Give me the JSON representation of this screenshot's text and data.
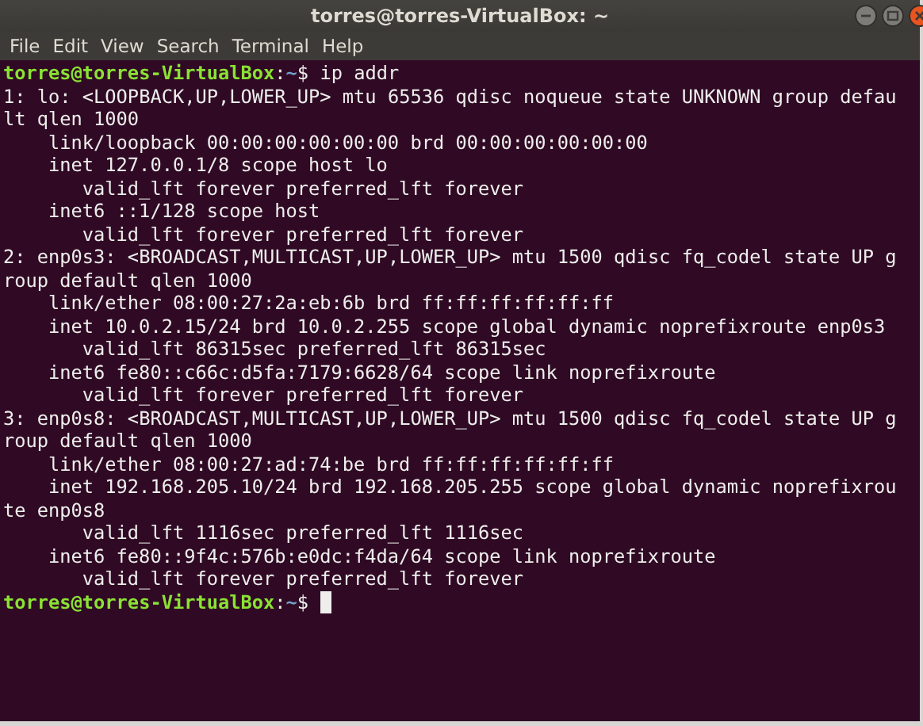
{
  "window": {
    "title": "torres@torres-VirtualBox: ~"
  },
  "menu": [
    "File",
    "Edit",
    "View",
    "Search",
    "Terminal",
    "Help"
  ],
  "terminal": {
    "lines": [
      {
        "kind": "prompt",
        "user_host": "torres@torres-VirtualBox",
        "separator": ":",
        "path": "~",
        "symbol": "$",
        "command": "ip addr",
        "cursor": false
      },
      {
        "kind": "line",
        "text": "1: lo: <LOOPBACK,UP,LOWER_UP> mtu 65536 qdisc noqueue state UNKNOWN group defau"
      },
      {
        "kind": "line",
        "text": "lt qlen 1000"
      },
      {
        "kind": "indented",
        "text": "link/loopback 00:00:00:00:00:00 brd 00:00:00:00:00:00"
      },
      {
        "kind": "indented",
        "text": "inet 127.0.0.1/8 scope host lo"
      },
      {
        "kind": "subindented",
        "text": "valid_lft forever preferred_lft forever"
      },
      {
        "kind": "indented",
        "text": "inet6 ::1/128 scope host"
      },
      {
        "kind": "subindented",
        "text": "valid_lft forever preferred_lft forever"
      },
      {
        "kind": "line",
        "text": "2: enp0s3: <BROADCAST,MULTICAST,UP,LOWER_UP> mtu 1500 qdisc fq_codel state UP g"
      },
      {
        "kind": "line",
        "text": "roup default qlen 1000"
      },
      {
        "kind": "indented",
        "text": "link/ether 08:00:27:2a:eb:6b brd ff:ff:ff:ff:ff:ff"
      },
      {
        "kind": "indented",
        "text": "inet 10.0.2.15/24 brd 10.0.2.255 scope global dynamic noprefixroute enp0s3"
      },
      {
        "kind": "subindented",
        "text": "valid_lft 86315sec preferred_lft 86315sec"
      },
      {
        "kind": "indented",
        "text": "inet6 fe80::c66c:d5fa:7179:6628/64 scope link noprefixroute"
      },
      {
        "kind": "subindented",
        "text": "valid_lft forever preferred_lft forever"
      },
      {
        "kind": "line",
        "text": "3: enp0s8: <BROADCAST,MULTICAST,UP,LOWER_UP> mtu 1500 qdisc fq_codel state UP g"
      },
      {
        "kind": "line",
        "text": "roup default qlen 1000"
      },
      {
        "kind": "indented",
        "text": "link/ether 08:00:27:ad:74:be brd ff:ff:ff:ff:ff:ff"
      },
      {
        "kind": "indented",
        "text": "inet 192.168.205.10/24 brd 192.168.205.255 scope global dynamic noprefixrou"
      },
      {
        "kind": "line",
        "text": "te enp0s8"
      },
      {
        "kind": "subindented",
        "text": "valid_lft 1116sec preferred_lft 1116sec"
      },
      {
        "kind": "indented",
        "text": "inet6 fe80::9f4c:576b:e0dc:f4da/64 scope link noprefixroute"
      },
      {
        "kind": "subindented",
        "text": "valid_lft forever preferred_lft forever"
      },
      {
        "kind": "prompt",
        "user_host": "torres@torres-VirtualBox",
        "separator": ":",
        "path": "~",
        "symbol": "$",
        "cursor": true
      }
    ]
  }
}
